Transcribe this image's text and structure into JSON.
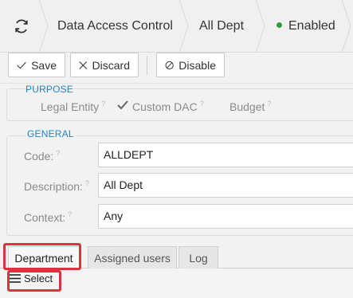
{
  "header": {
    "breadcrumbs": [
      "Data Access Control",
      "All Dept"
    ],
    "status": "Enabled",
    "status_color": "#2e9e3e",
    "refresh_icon": "refresh-icon"
  },
  "toolbar": {
    "save_label": "Save",
    "discard_label": "Discard",
    "disable_label": "Disable"
  },
  "purpose": {
    "title": "PURPOSE",
    "items": [
      {
        "label": "Legal Entity",
        "help": "?",
        "checked": false
      },
      {
        "label": "Custom DAC",
        "help": "?",
        "checked": true
      },
      {
        "label": "Budget",
        "help": "?",
        "checked": false
      }
    ]
  },
  "general": {
    "title": "GENERAL",
    "fields": [
      {
        "label": "Code:",
        "help": "?",
        "value": "ALLDEPT"
      },
      {
        "label": "Description:",
        "help": "?",
        "value": "All Dept"
      },
      {
        "label": "Context:",
        "help": "?",
        "value": "Any"
      }
    ]
  },
  "tabs": [
    {
      "label": "Department",
      "active": true
    },
    {
      "label": "Assigned users",
      "active": false
    },
    {
      "label": "Log",
      "active": false
    }
  ],
  "tab_toolbar": {
    "select_label": "Select"
  },
  "highlight_color": "#d9333f"
}
